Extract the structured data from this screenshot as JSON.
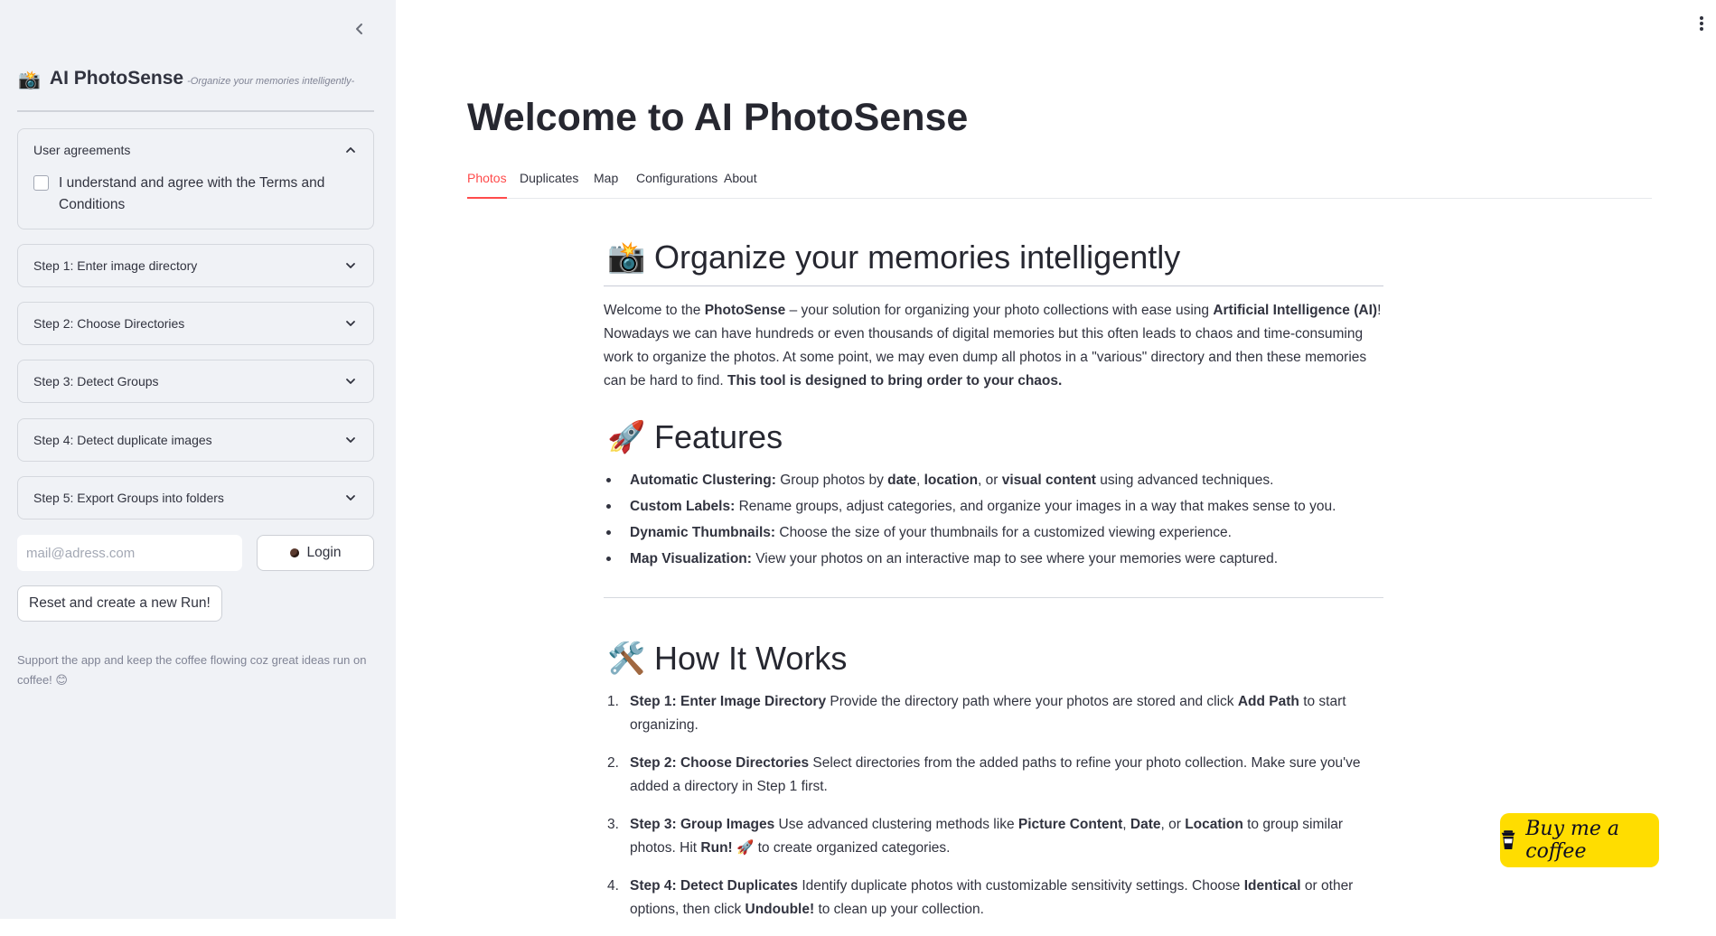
{
  "sidebar": {
    "brand_emoji": "📸",
    "brand_title": "AI PhotoSense",
    "brand_subtitle": "-Organize your memories intelligently-",
    "user_agreements": {
      "title": "User agreements",
      "checkbox_label": "I understand and agree with the Terms and Conditions",
      "checked": false
    },
    "steps": [
      {
        "label": "Step 1: Enter image directory"
      },
      {
        "label": "Step 2: Choose Directories"
      },
      {
        "label": "Step 3: Detect Groups"
      },
      {
        "label": "Step 4: Detect duplicate images"
      },
      {
        "label": "Step 5: Export Groups into folders"
      }
    ],
    "email_placeholder": "mail@adress.com",
    "email_value": "",
    "login_label": "Login",
    "reset_label": "Reset and create a new Run!",
    "support_text": "Support the app and keep the coffee flowing coz great ideas run on coffee! 😊"
  },
  "main": {
    "title": "Welcome to AI PhotoSense",
    "tabs": [
      {
        "label": "Photos",
        "active": true
      },
      {
        "label": "Duplicates",
        "active": false
      },
      {
        "label": "Map",
        "active": false
      },
      {
        "label": "Configurations",
        "active": false
      },
      {
        "label": "About",
        "active": false
      }
    ],
    "organize": {
      "emoji": "📸",
      "heading": "Organize your memories intelligently",
      "intro": {
        "t1": "Welcome to the ",
        "b1": "PhotoSense",
        "t2": " – your solution for organizing your photo collections with ease using ",
        "b2": "Artificial Intelligence (AI)",
        "t3": "! Nowadays we can have hundreds or even thousands of digital memories but this often leads to chaos and time-consuming work to organize the photos. At some point, we may even dump all photos in a \"various\" directory and then these memories can be hard to find. ",
        "b3": "This tool is designed to bring order to your chaos."
      }
    },
    "features": {
      "emoji": "🚀",
      "heading": "Features",
      "items": [
        {
          "bold": "Automatic Clustering:",
          "t1": " Group photos by ",
          "b1": "date",
          "t2": ", ",
          "b2": "location",
          "t3": ", or ",
          "b3": "visual content",
          "t4": " using advanced techniques."
        },
        {
          "bold": "Custom Labels:",
          "text": " Rename groups, adjust categories, and organize your images in a way that makes sense to you."
        },
        {
          "bold": "Dynamic Thumbnails:",
          "text": " Choose the size of your thumbnails for a customized viewing experience."
        },
        {
          "bold": "Map Visualization:",
          "text": " View your photos on an interactive map to see where your memories were captured."
        }
      ]
    },
    "how": {
      "emoji": "🛠️",
      "heading": "How It Works",
      "steps": [
        {
          "num": "1.",
          "bold": "Step 1: Enter Image Directory",
          "t1": " Provide the directory path where your photos are stored and click ",
          "b1": "Add Path",
          "t2": " to start organizing."
        },
        {
          "num": "2.",
          "bold": "Step 2: Choose Directories",
          "t1": " Select directories from the added paths to refine your photo collection. Make sure you've added a directory in Step 1 first."
        },
        {
          "num": "3.",
          "bold": "Step 3: Group Images",
          "t1": " Use advanced clustering methods like ",
          "b1": "Picture Content",
          "t2": ", ",
          "b2": "Date",
          "t3": ", or ",
          "b3": "Location",
          "t4": " to group similar photos. Hit ",
          "b4": "Run! 🚀",
          "t5": " to create organized categories."
        },
        {
          "num": "4.",
          "bold": "Step 4: Detect Duplicates",
          "t1": " Identify duplicate photos with customizable sensitivity settings. Choose ",
          "b1": "Identical",
          "t2": " or other options, then click ",
          "b2": "Undouble!",
          "t3": " to clean up your collection."
        }
      ]
    }
  },
  "coffee_button": {
    "label": "Buy me a coffee",
    "color": "#ffdd00"
  },
  "colors": {
    "accent": "#ff4b4b",
    "sidebar_bg": "#f0f2f6",
    "text": "#31333f"
  }
}
